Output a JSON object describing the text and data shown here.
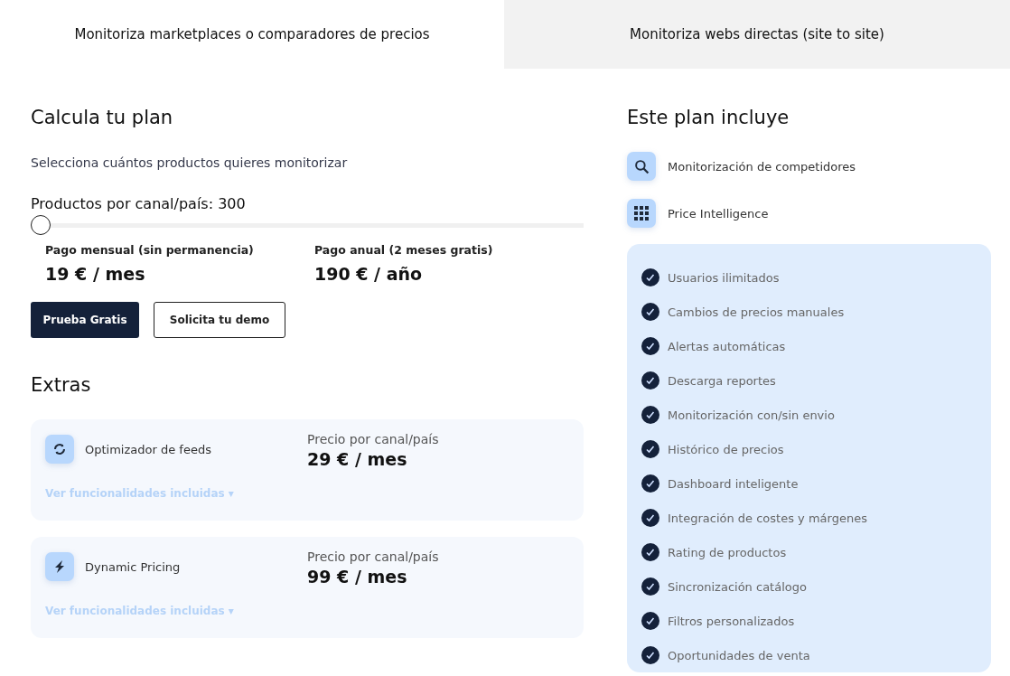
{
  "tabs": [
    {
      "label": "Monitoriza marketplaces o comparadores de precios",
      "selected": true
    },
    {
      "label": "Monitoriza webs directas (site to site)",
      "selected": false
    }
  ],
  "calculator": {
    "title": "Calcula tu plan",
    "subtitle": "Selecciona cuántos productos quieres monitorizar",
    "slider_label": "Productos por canal/país: 300",
    "slider": {
      "level": 0
    },
    "prices": [
      {
        "label": "Pago mensual (sin permanencia)",
        "value": "19 € / mes"
      },
      {
        "label": "Pago anual (2 meses gratis)",
        "value": "190 € / año"
      }
    ],
    "buttons": [
      {
        "label": "Prueba Gratis",
        "kind": "primary"
      },
      {
        "label": "Solicita tu demo",
        "kind": "outline"
      }
    ]
  },
  "extras": {
    "title": "Extras",
    "items": [
      {
        "kind": "refresh",
        "name": "Optimizador de feeds",
        "price_label": "Precio por canal/país",
        "price": "29 € / mes",
        "link": "Ver funcionalidades incluidas ▾"
      },
      {
        "kind": "bolt",
        "name": "Dynamic Pricing",
        "price_label": "Precio por canal/país",
        "price": "99 € / mes",
        "link": "Ver funcionalidades incluidas ▾"
      }
    ]
  },
  "plan": {
    "title": "Este plan incluye",
    "modules": [
      {
        "kind": "search",
        "label": "Monitorización de competidores"
      },
      {
        "kind": "grid",
        "label": "Price Intelligence"
      }
    ],
    "features": [
      "Usuarios ilimitados",
      "Cambios de precios manuales",
      "Alertas automáticas",
      "Descarga reportes",
      "Monitorización con/sin envio",
      "Histórico de precios",
      "Dashboard inteligente",
      "Integración de costes y márgenes",
      "Rating de productos",
      "Sincronización catálogo",
      "Filtros personalizados",
      "Oportunidades de venta"
    ]
  }
}
